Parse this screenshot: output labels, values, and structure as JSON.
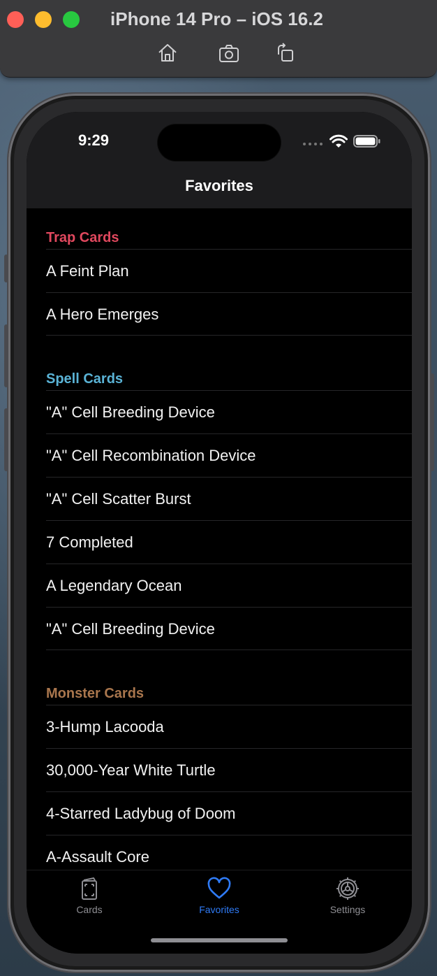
{
  "simulator": {
    "title": "iPhone 14 Pro – iOS 16.2",
    "toolbar": [
      "home-icon",
      "screenshot-icon",
      "rotate-icon"
    ]
  },
  "status_bar": {
    "time": "9:29"
  },
  "nav": {
    "title": "Favorites"
  },
  "sections": [
    {
      "header": "Trap Cards",
      "color": "#e0485e",
      "items": [
        "A Feint Plan",
        "A Hero Emerges"
      ]
    },
    {
      "header": "Spell Cards",
      "color": "#5ab3d6",
      "items": [
        "\"A\" Cell Breeding Device",
        "\"A\" Cell Recombination Device",
        "\"A\" Cell Scatter Burst",
        "7 Completed",
        "A Legendary Ocean",
        "\"A\" Cell Breeding Device"
      ]
    },
    {
      "header": "Monster Cards",
      "color": "#a9764d",
      "items": [
        "3-Hump Lacooda",
        "30,000-Year White Turtle",
        "4-Starred Ladybug of Doom",
        "A-Assault Core"
      ]
    }
  ],
  "tabbar": {
    "cards": "Cards",
    "favorites": "Favorites",
    "settings": "Settings",
    "active_color": "#2f7bf6",
    "inactive_color": "#8e8e93"
  }
}
